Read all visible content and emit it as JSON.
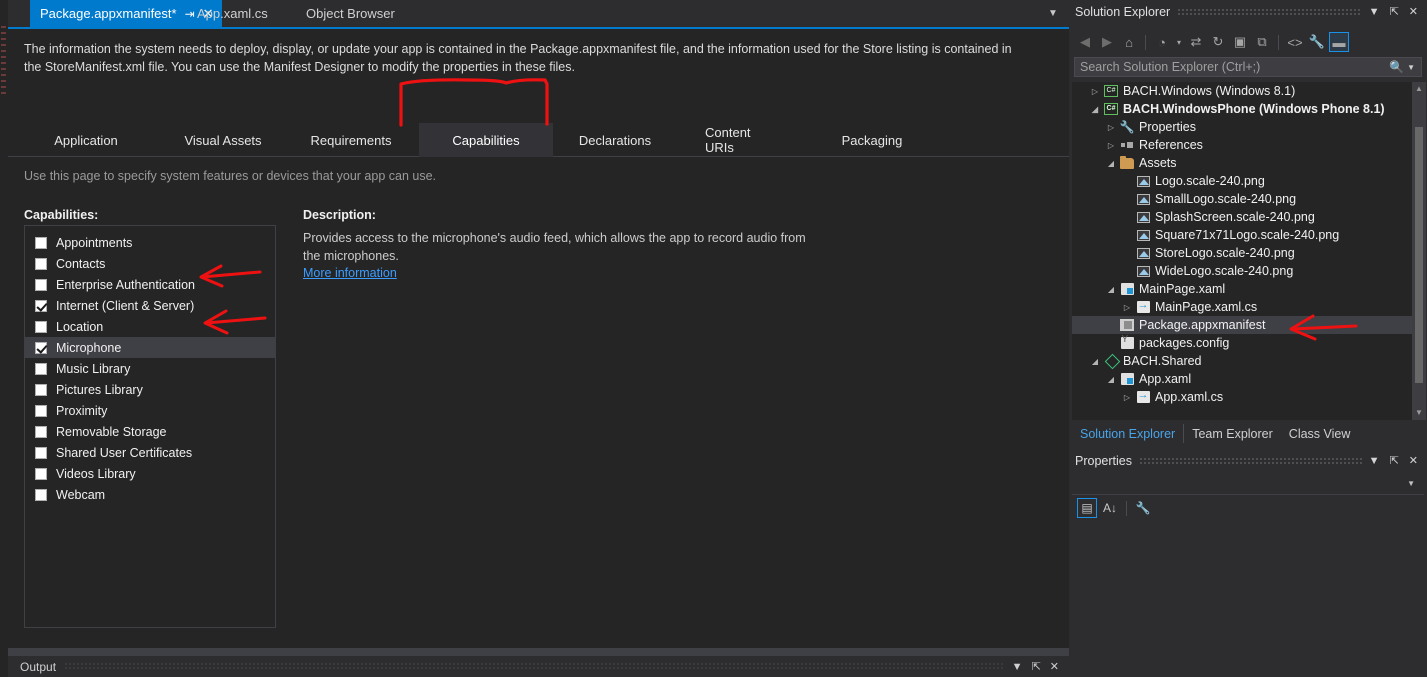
{
  "editor": {
    "tabs": [
      {
        "label": "Package.appxmanifest*",
        "active": true,
        "pin": "⇥",
        "close": "✕"
      },
      {
        "label": "App.xaml.cs",
        "active": false
      },
      {
        "label": "Object Browser",
        "active": false
      }
    ],
    "overflow_icon": "▼"
  },
  "manifest": {
    "description": "The information the system needs to deploy, display, or update your app is contained in the Package.appxmanifest file, and the information used for the Store listing is contained in the StoreManifest.xml file. You can use the Manifest Designer to modify the properties in these files.",
    "page_tabs": [
      {
        "label": "Application",
        "selected": false
      },
      {
        "label": "Visual Assets",
        "selected": false
      },
      {
        "label": "Requirements",
        "selected": false
      },
      {
        "label": "Capabilities",
        "selected": true
      },
      {
        "label": "Declarations",
        "selected": false
      },
      {
        "label": "Content URIs",
        "selected": false
      },
      {
        "label": "Packaging",
        "selected": false
      }
    ],
    "page_hint": "Use this page to specify system features or devices that your app can use.",
    "capabilities_label": "Capabilities:",
    "capabilities": [
      {
        "label": "Appointments",
        "checked": false,
        "selected": false
      },
      {
        "label": "Contacts",
        "checked": false,
        "selected": false
      },
      {
        "label": "Enterprise Authentication",
        "checked": false,
        "selected": false
      },
      {
        "label": "Internet (Client & Server)",
        "checked": true,
        "selected": false
      },
      {
        "label": "Location",
        "checked": false,
        "selected": false
      },
      {
        "label": "Microphone",
        "checked": true,
        "selected": true
      },
      {
        "label": "Music Library",
        "checked": false,
        "selected": false
      },
      {
        "label": "Pictures Library",
        "checked": false,
        "selected": false
      },
      {
        "label": "Proximity",
        "checked": false,
        "selected": false
      },
      {
        "label": "Removable Storage",
        "checked": false,
        "selected": false
      },
      {
        "label": "Shared User Certificates",
        "checked": false,
        "selected": false
      },
      {
        "label": "Videos Library",
        "checked": false,
        "selected": false
      },
      {
        "label": "Webcam",
        "checked": false,
        "selected": false
      }
    ],
    "description_label": "Description:",
    "description_text": "Provides access to the microphone's audio feed, which allows the app to record audio from the microphones.",
    "more_info_link": "More information"
  },
  "output": {
    "title": "Output",
    "buttons": [
      "▼",
      "⇱",
      "✕"
    ]
  },
  "solution_explorer": {
    "title": "Solution Explorer",
    "header_buttons": [
      "▼",
      "⇱",
      "✕"
    ],
    "toolbar": [
      {
        "name": "back",
        "glyph": "◀",
        "state": "dim"
      },
      {
        "name": "forward",
        "glyph": "▶",
        "state": "dim"
      },
      {
        "name": "home",
        "glyph": "⌂",
        "state": "normal"
      },
      {
        "name": "pending-changes",
        "glyph": "◔",
        "state": "normal"
      },
      {
        "name": "pending-changes-dropdown",
        "glyph": "▾",
        "state": "normal"
      },
      {
        "name": "sync-with-active-document",
        "glyph": "⇄",
        "state": "normal"
      },
      {
        "name": "refresh",
        "glyph": "↻",
        "state": "normal"
      },
      {
        "name": "collapse-all",
        "glyph": "▣",
        "state": "normal"
      },
      {
        "name": "show-all-files",
        "glyph": "⧉",
        "state": "normal"
      },
      {
        "name": "view-code",
        "glyph": "<>",
        "state": "normal"
      },
      {
        "name": "properties",
        "glyph": "🔧",
        "state": "normal"
      },
      {
        "name": "preview-selected-items",
        "glyph": "▬",
        "state": "active"
      }
    ],
    "search_placeholder": "Search Solution Explorer (Ctrl+;)",
    "search_value": "",
    "search_icon": "search-icon",
    "tree": [
      {
        "indent": 1,
        "twisty": "▷",
        "icon": "csproj",
        "label": "BACH.Windows (Windows 8.1)",
        "bold": false,
        "selected": false
      },
      {
        "indent": 1,
        "twisty": "◢",
        "icon": "csproj",
        "label": "BACH.WindowsPhone (Windows Phone 8.1)",
        "bold": true,
        "selected": false
      },
      {
        "indent": 2,
        "twisty": "▷",
        "icon": "wrench",
        "label": "Properties",
        "bold": false,
        "selected": false
      },
      {
        "indent": 2,
        "twisty": "▷",
        "icon": "references",
        "label": "References",
        "bold": false,
        "selected": false
      },
      {
        "indent": 2,
        "twisty": "◢",
        "icon": "folder",
        "label": "Assets",
        "bold": false,
        "selected": false
      },
      {
        "indent": 3,
        "twisty": "",
        "icon": "image",
        "label": "Logo.scale-240.png",
        "bold": false,
        "selected": false
      },
      {
        "indent": 3,
        "twisty": "",
        "icon": "image",
        "label": "SmallLogo.scale-240.png",
        "bold": false,
        "selected": false
      },
      {
        "indent": 3,
        "twisty": "",
        "icon": "image",
        "label": "SplashScreen.scale-240.png",
        "bold": false,
        "selected": false
      },
      {
        "indent": 3,
        "twisty": "",
        "icon": "image",
        "label": "Square71x71Logo.scale-240.png",
        "bold": false,
        "selected": false
      },
      {
        "indent": 3,
        "twisty": "",
        "icon": "image",
        "label": "StoreLogo.scale-240.png",
        "bold": false,
        "selected": false
      },
      {
        "indent": 3,
        "twisty": "",
        "icon": "image",
        "label": "WideLogo.scale-240.png",
        "bold": false,
        "selected": false
      },
      {
        "indent": 2,
        "twisty": "◢",
        "icon": "xaml",
        "label": "MainPage.xaml",
        "bold": false,
        "selected": false
      },
      {
        "indent": 3,
        "twisty": "▷",
        "icon": "cscode",
        "label": "MainPage.xaml.cs",
        "bold": false,
        "selected": false
      },
      {
        "indent": 2,
        "twisty": "",
        "icon": "manifest",
        "label": "Package.appxmanifest",
        "bold": false,
        "selected": true
      },
      {
        "indent": 2,
        "twisty": "",
        "icon": "config",
        "label": "packages.config",
        "bold": false,
        "selected": false
      },
      {
        "indent": 1,
        "twisty": "◢",
        "icon": "shared",
        "label": "BACH.Shared",
        "bold": false,
        "selected": false
      },
      {
        "indent": 2,
        "twisty": "◢",
        "icon": "xaml",
        "label": "App.xaml",
        "bold": false,
        "selected": false
      },
      {
        "indent": 3,
        "twisty": "▷",
        "icon": "cscode",
        "label": "App.xaml.cs",
        "bold": false,
        "selected": false
      }
    ],
    "scrollbar": {
      "up": "▲",
      "down": "▼"
    },
    "bottom_tabs": [
      {
        "label": "Solution Explorer",
        "active": true
      },
      {
        "label": "Team Explorer",
        "active": false
      },
      {
        "label": "Class View",
        "active": false
      }
    ]
  },
  "properties_panel": {
    "title": "Properties",
    "header_buttons": [
      "▼",
      "⇱",
      "✕"
    ],
    "combo_arrow": "▼",
    "toolbar": [
      {
        "name": "categorized",
        "glyph": "▤",
        "state": "boxed"
      },
      {
        "name": "alphabetical",
        "glyph": "A↓",
        "state": "normal"
      },
      {
        "name": "property-pages",
        "glyph": "🔧",
        "state": "dim"
      }
    ]
  },
  "colors": {
    "accent": "#007acc",
    "background": "#2d2d30",
    "panel": "#252526",
    "selection": "#3f3f46",
    "link": "#3b9dff",
    "annotation": "#ee1111"
  }
}
